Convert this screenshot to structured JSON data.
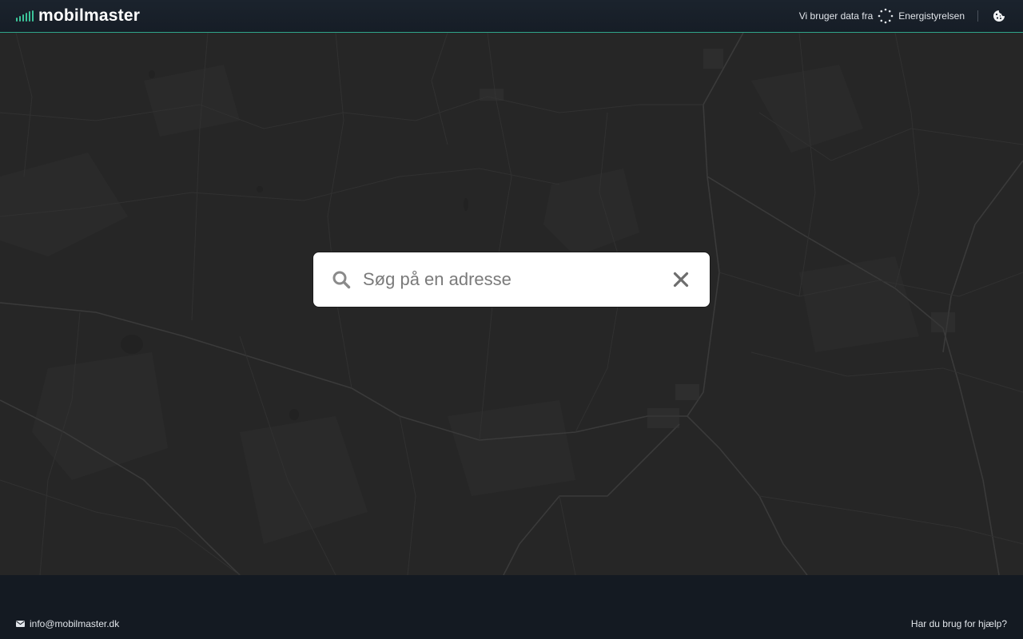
{
  "header": {
    "brand": "mobilmaster",
    "source_prefix": "Vi bruger data fra",
    "source_name": "Energistyrelsen",
    "accent_color": "#3cc49a"
  },
  "search": {
    "placeholder": "Søg på en adresse",
    "value": ""
  },
  "icons": {
    "search": "search-icon",
    "clear": "close-icon",
    "cookie": "cookie-icon",
    "email": "envelope-icon",
    "signal": "signal-bars-icon",
    "source_logo": "sun-dots-icon"
  },
  "footer": {
    "email": "info@mobilmaster.dk",
    "help": "Har du brug for hjælp?"
  },
  "colors": {
    "header_bg": "#1a222c",
    "map_bg": "#262626",
    "footer_bg": "#141a22",
    "divider": "#2fa58a"
  }
}
